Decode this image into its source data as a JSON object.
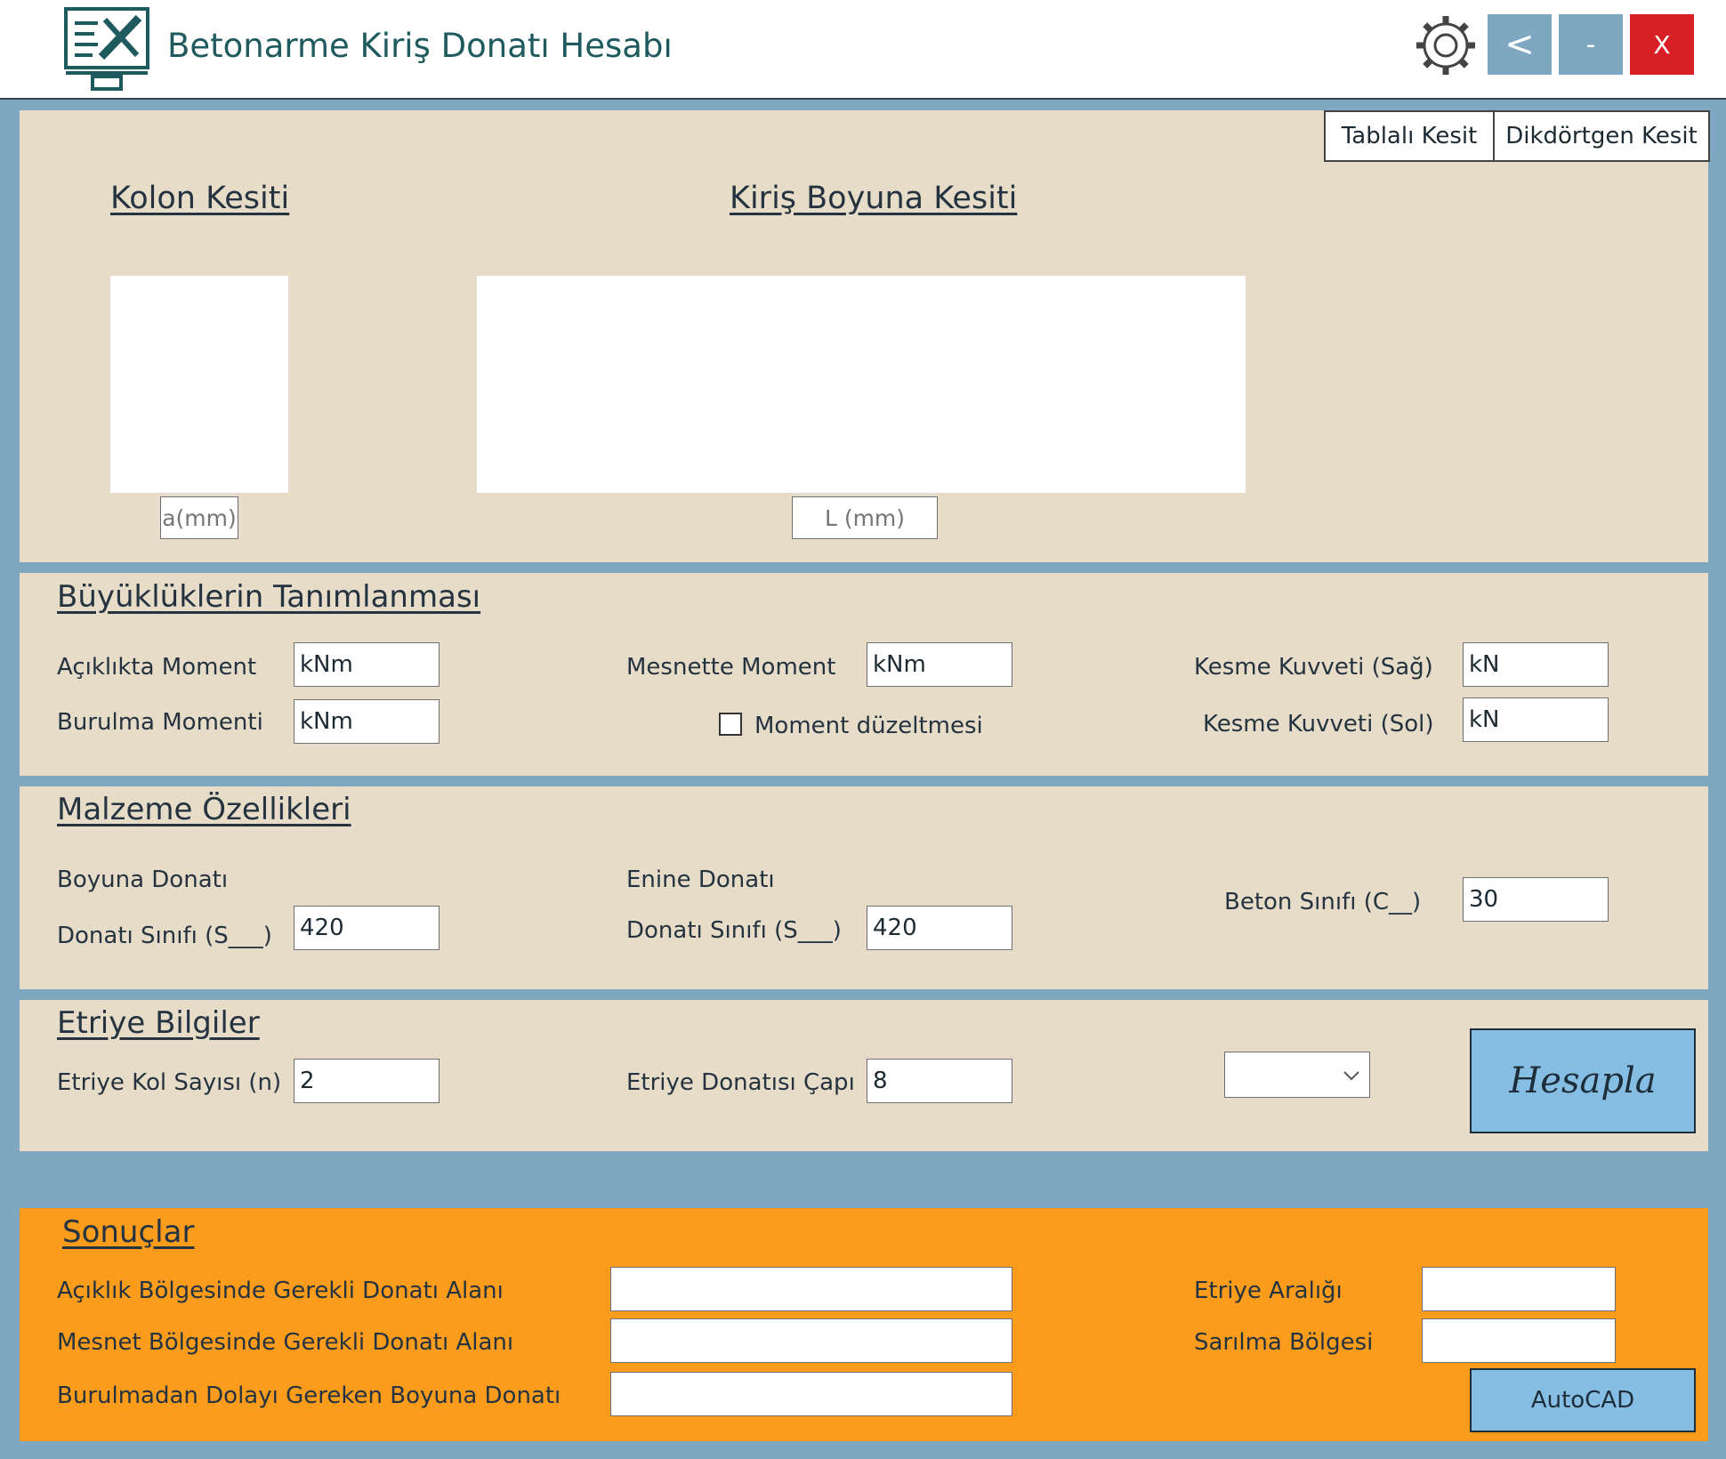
{
  "app": {
    "title": "Betonarme Kiriş Donatı Hesabı",
    "buttons": {
      "back": "<",
      "minimize": "-",
      "close": "X"
    }
  },
  "section_tabs": [
    "Tablalı Kesit",
    "Dikdörtgen Kesit"
  ],
  "drawing": {
    "kolon_title": "Kolon Kesiti",
    "kiris_title": "Kiriş Boyuna Kesiti",
    "kolon_dim_placeholder": "a(mm)",
    "kiris_dim_placeholder": "L (mm)"
  },
  "loads": {
    "title": "Büyüklüklerin Tanımlanması",
    "aciklikta_moment": {
      "label": "Açıklıkta Moment",
      "value": "kNm"
    },
    "burulma_momenti": {
      "label": "Burulma Momenti",
      "value": "kNm"
    },
    "mesnette_moment": {
      "label": "Mesnette Moment",
      "value": "kNm"
    },
    "moment_duzeltmesi": {
      "label": "Moment düzeltmesi",
      "checked": false
    },
    "kesme_sag": {
      "label": "Kesme Kuvveti (Sağ)",
      "value": "kN"
    },
    "kesme_sol": {
      "label": "Kesme Kuvveti (Sol)",
      "value": "kN"
    }
  },
  "material": {
    "title": "Malzeme Özellikleri",
    "boyuna_title": "Boyuna Donatı",
    "boyuna_sinif_label": "Donatı Sınıfı (S___)",
    "boyuna_sinif_value": "420",
    "enine_title": "Enine Donatı",
    "enine_sinif_label": "Donatı Sınıfı (S___)",
    "enine_sinif_value": "420",
    "beton_label": "Beton Sınıfı (C__)",
    "beton_value": "30"
  },
  "stirrup": {
    "title": "Etriye Bilgiler",
    "kol_sayisi_label": "Etriye Kol Sayısı (n)",
    "kol_sayisi_value": "2",
    "cap_label": "Etriye Donatısı Çapı",
    "cap_value": "8",
    "dropdown_value": "",
    "calc_button": "Hesapla"
  },
  "results": {
    "title": "Sonuçlar",
    "aciklik_label": "Açıklık Bölgesinde Gerekli Donatı Alanı",
    "aciklik_value": "",
    "mesnet_label": "Mesnet Bölgesinde Gerekli Donatı Alanı",
    "mesnet_value": "",
    "burulma_label": "Burulmadan Dolayı Gereken Boyuna Donatı",
    "burulma_value": "",
    "etriye_araligi_label": "Etriye Aralığı",
    "etriye_araligi_value": "",
    "sarilma_label": "Sarılma Bölgesi",
    "sarilma_value": "",
    "autocad_button": "AutoCAD"
  },
  "colors": {
    "background": "#7fa7c2",
    "panel": "#e6dcc7",
    "results_panel": "#fb9c1c",
    "window_button": "#7fa7c2",
    "close_button": "#d71f26",
    "calc_button": "#86bde2"
  }
}
